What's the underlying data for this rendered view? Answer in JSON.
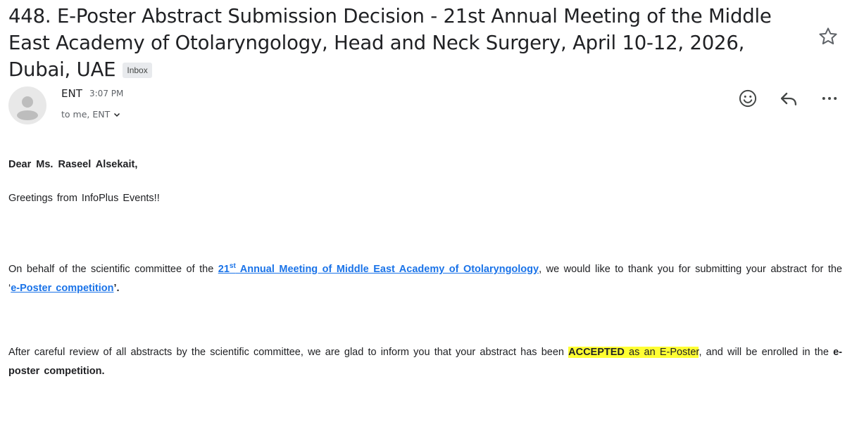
{
  "email": {
    "subject": "448. E-Poster Abstract Submission Decision - 21st Annual Meeting of the Middle East Academy of Otolaryngology, Head and Neck Surgery, April 10-12, 2026, Dubai, UAE",
    "label_badge": "Inbox",
    "sender": "ENT",
    "time": "3:07 PM",
    "recipients": "to me, ENT"
  },
  "icons": {
    "star": "star-outline-icon",
    "avatar": "person-avatar-icon",
    "emoji": "smiley-icon",
    "reply": "reply-icon",
    "more": "more-horizontal-icon",
    "details": "chevron-down-icon"
  },
  "message": {
    "salutation": "Dear Ms. Raseel Alsekait,",
    "greeting": "Greetings from InfoPlus Events!!",
    "p1_before": "On behalf of the scientific committee of the ",
    "p1_link_num": "21",
    "p1_link_sup": "st",
    "p1_link_rest": " Annual Meeting of Middle East Academy of Otolaryngology",
    "p1_middle": ", we would like to thank you for submitting your abstract for the ‘",
    "p1_link2": "e-Poster competition",
    "p1_end": "’.",
    "p2_before": "After careful review of all abstracts by the scientific committee, we are glad to inform you that your abstract has been ",
    "p2_accepted": "ACCEPTED",
    "p2_as": " as an E-Poster",
    "p2_middle": ", and will be enrolled in the ",
    "p2_bold": "e-poster competition."
  },
  "colors": {
    "link": "#1a73e8",
    "highlight": "#ffff33",
    "badge_bg": "#e8eaed"
  }
}
